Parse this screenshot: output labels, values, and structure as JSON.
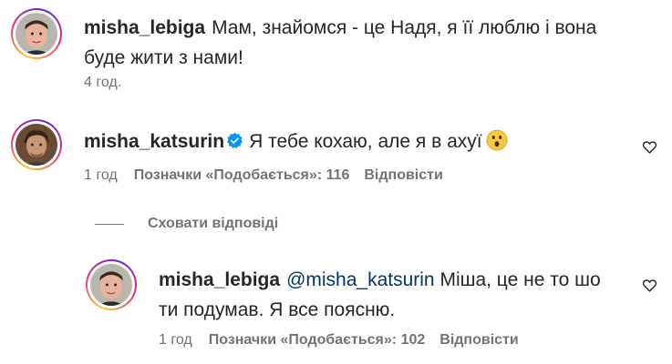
{
  "comments": [
    {
      "username": "misha_lebiga",
      "text_line1": "Мам, знайомся - це Надя, я її люблю і вона",
      "text_line2": "буде жити з нами!",
      "time": "4 год."
    },
    {
      "username": "misha_katsurin",
      "verified": true,
      "text": "Я тебе кохаю, але я в ахуї",
      "emoji": "astonished-face",
      "time": "1 год",
      "likes": "Позначки «Подобається»: 116",
      "reply": "Відповісти"
    }
  ],
  "hide_replies": "Сховати відповіді",
  "reply": {
    "username": "misha_lebiga",
    "mention": "@misha_katsurin",
    "text_line1": "Міша, це не то шо",
    "text_line2": "ти подумав. Я все поясню.",
    "time": "1 год",
    "likes": "Позначки «Подобається»: 102",
    "reply": "Відповісти"
  },
  "icons": {
    "heart": "heart-outline-icon",
    "verified": "verified-badge-icon"
  },
  "colors": {
    "username": "#262626",
    "meta": "#737373",
    "mention": "#00376b",
    "verified": "#0095f6"
  }
}
